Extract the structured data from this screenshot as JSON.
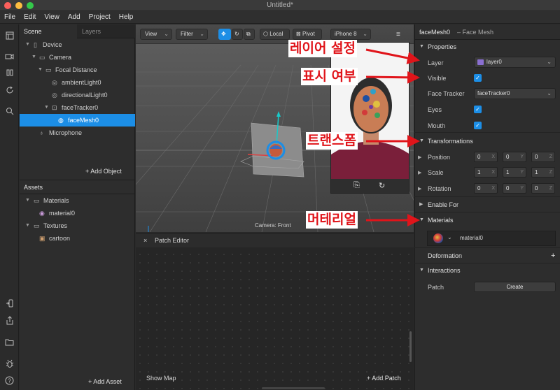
{
  "window": {
    "title": "Untitled*"
  },
  "menu": [
    "File",
    "Edit",
    "View",
    "Add",
    "Project",
    "Help"
  ],
  "toolstrip": {
    "icons": [
      "layout-icon",
      "camera-icon",
      "pause-icon",
      "refresh-icon",
      "search-icon",
      "device-icon",
      "share-icon",
      "folder-icon",
      "bug-icon",
      "help-icon"
    ],
    "help_glyph": "?"
  },
  "scene_panel": {
    "tabs": [
      "Scene",
      "Layers"
    ],
    "tree": [
      {
        "label": "Device",
        "icon": "phone-icon"
      },
      {
        "label": "Camera",
        "icon": "camera-icon"
      },
      {
        "label": "Focal Distance",
        "icon": "focal-distance-icon"
      },
      {
        "label": "ambientLight0",
        "icon": "light-icon"
      },
      {
        "label": "directionalLight0",
        "icon": "light-icon"
      },
      {
        "label": "faceTracker0",
        "icon": "face-tracker-icon"
      },
      {
        "label": "faceMesh0",
        "icon": "face-mesh-icon"
      },
      {
        "label": "Microphone",
        "icon": "microphone-icon"
      }
    ],
    "add_object": "Add Object",
    "assets_title": "Assets",
    "assets": [
      {
        "label": "Materials",
        "icon": "folder-icon"
      },
      {
        "label": "material0",
        "icon": "material-icon"
      },
      {
        "label": "Textures",
        "icon": "folder-icon"
      },
      {
        "label": "cartoon",
        "icon": "texture-icon"
      }
    ],
    "add_asset": "Add Asset"
  },
  "viewport": {
    "view": "View",
    "filter": "Filter",
    "local": "Local",
    "pivot": "Pivot",
    "device": "iPhone 8",
    "camera_label": "Camera: Front"
  },
  "patch_editor": {
    "title": "Patch Editor",
    "show_map": "Show Map",
    "add_patch": "Add Patch"
  },
  "inspector": {
    "object_name": "faceMesh0",
    "object_type": "– Face Mesh",
    "properties_title": "Properties",
    "layer_label": "Layer",
    "layer_value": "layer0",
    "visible_label": "Visible",
    "face_tracker_label": "Face Tracker",
    "face_tracker_value": "faceTracker0",
    "eyes_label": "Eyes",
    "mouth_label": "Mouth",
    "transformations_title": "Transformations",
    "position_label": "Position",
    "position": [
      "0",
      "0",
      "0"
    ],
    "scale_label": "Scale",
    "scale": [
      "1",
      "1",
      "1"
    ],
    "rotation_label": "Rotation",
    "rotation": [
      "0",
      "0",
      "0"
    ],
    "axes": [
      "X",
      "Y",
      "Z"
    ],
    "enable_for_title": "Enable For",
    "materials_title": "Materials",
    "material_value": "material0",
    "deformation_title": "Deformation",
    "interactions_title": "Interactions",
    "patch_label": "Patch",
    "create_label": "Create"
  },
  "annotations": {
    "layer": "레이어 설정",
    "visible": "표시 여부",
    "transform": "트랜스폼",
    "material": "머테리얼",
    "color": "#e0141a"
  }
}
